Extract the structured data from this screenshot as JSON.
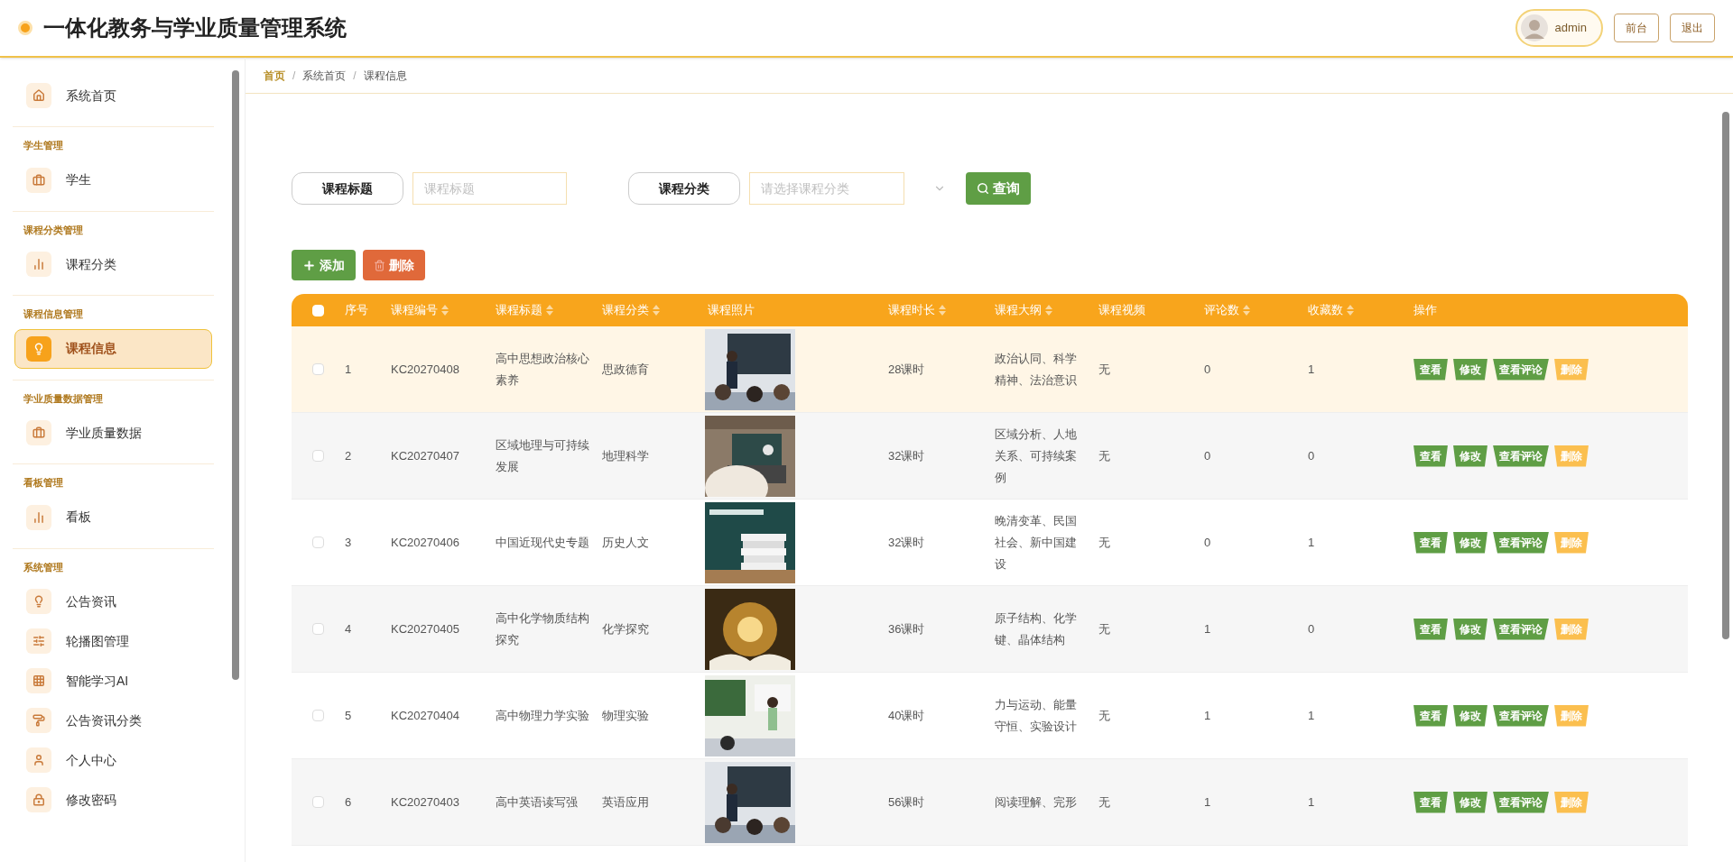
{
  "header": {
    "title": "一体化教务与学业质量管理系统",
    "user": "admin",
    "buttons": [
      "前台",
      "退出"
    ]
  },
  "sidebar": {
    "home": {
      "label": "系统首页",
      "selected": false
    },
    "sections": [
      {
        "heading": "学生管理",
        "items": [
          {
            "label": "学生",
            "selected": false
          }
        ]
      },
      {
        "heading": "课程分类管理",
        "items": [
          {
            "label": "课程分类",
            "selected": false
          }
        ]
      },
      {
        "heading": "课程信息管理",
        "items": [
          {
            "label": "课程信息",
            "selected": true
          }
        ]
      },
      {
        "heading": "学业质量数据管理",
        "items": [
          {
            "label": "学业质量数据",
            "selected": false
          }
        ]
      },
      {
        "heading": "看板管理",
        "items": [
          {
            "label": "看板",
            "selected": false
          }
        ]
      },
      {
        "heading": "系统管理",
        "items": [
          {
            "label": "公告资讯",
            "selected": false
          },
          {
            "label": "轮播图管理",
            "selected": false
          },
          {
            "label": "智能学习AI",
            "selected": false
          },
          {
            "label": "公告资讯分类",
            "selected": false
          },
          {
            "label": "个人中心",
            "selected": false
          },
          {
            "label": "修改密码",
            "selected": false
          }
        ]
      }
    ]
  },
  "breadcrumb": [
    {
      "label": "首页"
    },
    {
      "separator": "/",
      "label": "系统首页"
    },
    {
      "separator": "/",
      "label": "课程信息"
    }
  ],
  "search": {
    "fields": [
      {
        "label": "课程标题",
        "placeholder": "课程标题",
        "kind": "input"
      },
      {
        "label": "课程分类",
        "placeholder": "请选择课程分类",
        "kind": "select"
      }
    ],
    "button": "查询"
  },
  "toolbar": {
    "add": "添加",
    "delete": "删除"
  },
  "table": {
    "select_all": {
      "checked": false
    },
    "columns": [
      {
        "label": "序号",
        "sortable": false
      },
      {
        "label": "课程编号",
        "sortable": true
      },
      {
        "label": "课程标题",
        "sortable": true
      },
      {
        "label": "课程分类",
        "sortable": true
      },
      {
        "label": "课程照片",
        "sortable": false
      },
      {
        "label": "课程时长",
        "sortable": true
      },
      {
        "label": "课程大纲",
        "sortable": true
      },
      {
        "label": "课程视频",
        "sortable": false
      },
      {
        "label": "评论数",
        "sortable": true
      },
      {
        "label": "收藏数",
        "sortable": true
      },
      {
        "label": "操作",
        "sortable": false
      }
    ],
    "rows": [
      {
        "checked": false,
        "highlighted": true,
        "cells": [
          "1",
          "KC20270408",
          "高中思想政治核心素养",
          "思政德育",
          "",
          "28课时",
          "政治认同、科学精神、法治意识",
          "无",
          "0",
          "1"
        ],
        "actions": [
          {
            "label": "查看",
            "kind": "primary"
          },
          {
            "label": "修改",
            "kind": "primary"
          },
          {
            "label": "查看评论",
            "kind": "primary"
          },
          {
            "label": "删除",
            "kind": "danger"
          }
        ]
      },
      {
        "checked": false,
        "highlighted": false,
        "cells": [
          "2",
          "KC20270407",
          "区域地理与可持续发展",
          "地理科学",
          "",
          "32课时",
          "区域分析、人地关系、可持续案例",
          "无",
          "0",
          "0"
        ],
        "actions": [
          {
            "label": "查看",
            "kind": "primary"
          },
          {
            "label": "修改",
            "kind": "primary"
          },
          {
            "label": "查看评论",
            "kind": "primary"
          },
          {
            "label": "删除",
            "kind": "danger"
          }
        ]
      },
      {
        "checked": false,
        "highlighted": false,
        "cells": [
          "3",
          "KC20270406",
          "中国近现代史专题",
          "历史人文",
          "",
          "32课时",
          "晚清变革、民国社会、新中国建设",
          "无",
          "0",
          "1"
        ],
        "actions": [
          {
            "label": "查看",
            "kind": "primary"
          },
          {
            "label": "修改",
            "kind": "primary"
          },
          {
            "label": "查看评论",
            "kind": "primary"
          },
          {
            "label": "删除",
            "kind": "danger"
          }
        ]
      },
      {
        "checked": false,
        "highlighted": false,
        "cells": [
          "4",
          "KC20270405",
          "高中化学物质结构探究",
          "化学探究",
          "",
          "36课时",
          "原子结构、化学键、晶体结构",
          "无",
          "1",
          "0"
        ],
        "actions": [
          {
            "label": "查看",
            "kind": "primary"
          },
          {
            "label": "修改",
            "kind": "primary"
          },
          {
            "label": "查看评论",
            "kind": "primary"
          },
          {
            "label": "删除",
            "kind": "danger"
          }
        ]
      },
      {
        "checked": false,
        "highlighted": false,
        "cells": [
          "5",
          "KC20270404",
          "高中物理力学实验",
          "物理实验",
          "",
          "40课时",
          "力与运动、能量守恒、实验设计",
          "无",
          "1",
          "1"
        ],
        "actions": [
          {
            "label": "查看",
            "kind": "primary"
          },
          {
            "label": "修改",
            "kind": "primary"
          },
          {
            "label": "查看评论",
            "kind": "primary"
          },
          {
            "label": "删除",
            "kind": "danger"
          }
        ]
      },
      {
        "checked": false,
        "highlighted": false,
        "cells": [
          "6",
          "KC20270403",
          "高中英语读写强",
          "英语应用",
          "",
          "56课时",
          "阅读理解、完形",
          "无",
          "1",
          "1"
        ],
        "actions": [
          {
            "label": "查看",
            "kind": "primary"
          },
          {
            "label": "修改",
            "kind": "primary"
          },
          {
            "label": "查看评论",
            "kind": "primary"
          },
          {
            "label": "删除",
            "kind": "danger"
          }
        ]
      }
    ]
  }
}
